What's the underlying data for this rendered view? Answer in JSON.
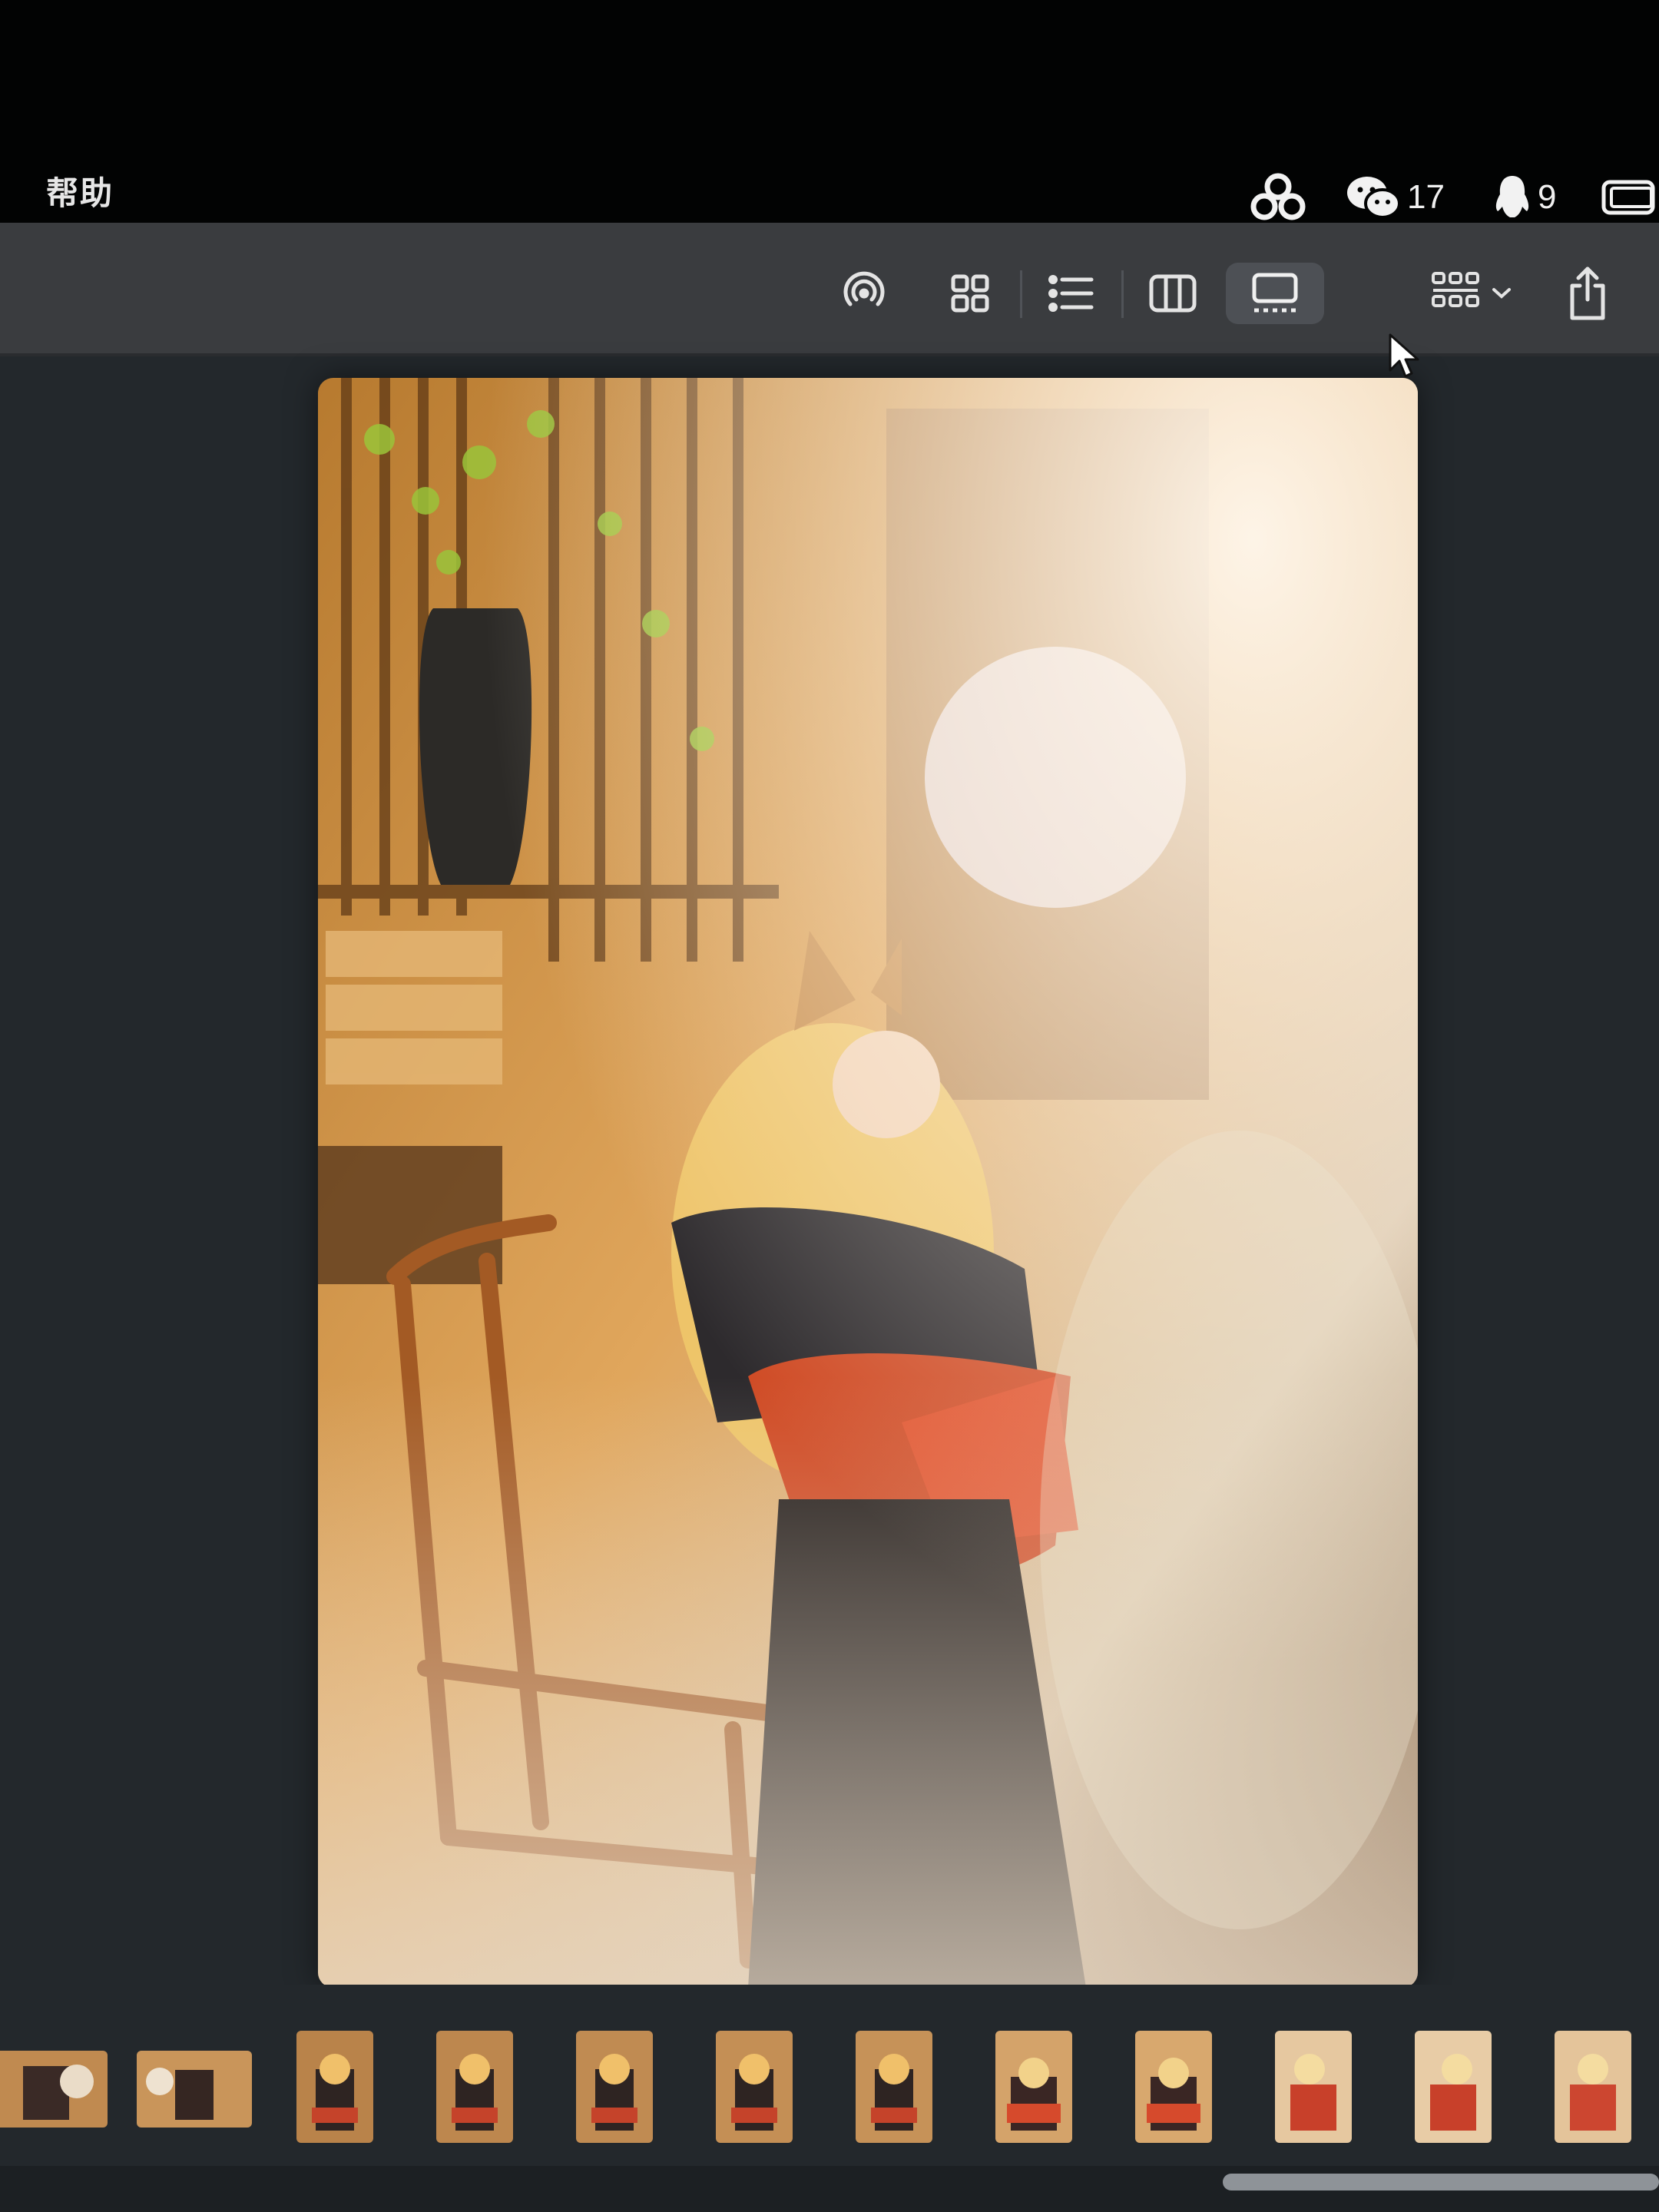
{
  "menubar": {
    "help_label": "帮助",
    "status_items": [
      {
        "icon": "cloud-sync-icon",
        "count": ""
      },
      {
        "icon": "wechat-icon",
        "count": "17"
      },
      {
        "icon": "qq-penguin-icon",
        "count": "9"
      },
      {
        "icon": "screen-mirror-icon",
        "count": ""
      }
    ]
  },
  "toolbar": {
    "buttons": [
      {
        "icon": "airdrop-icon"
      },
      {
        "icon": "icon-view-icon"
      },
      {
        "icon": "list-view-icon"
      },
      {
        "icon": "column-view-icon"
      },
      {
        "icon": "gallery-view-icon",
        "active": true
      },
      {
        "icon": "group-by-icon"
      },
      {
        "icon": "share-icon"
      }
    ]
  },
  "preview": {
    "image": "photo-preview",
    "palette": {
      "warm": "#d9a35a",
      "red": "#d44a28",
      "dark": "#2b2b2b",
      "haze": "#efe4d2"
    }
  },
  "filmstrip": {
    "thumbnail_count": 12
  }
}
